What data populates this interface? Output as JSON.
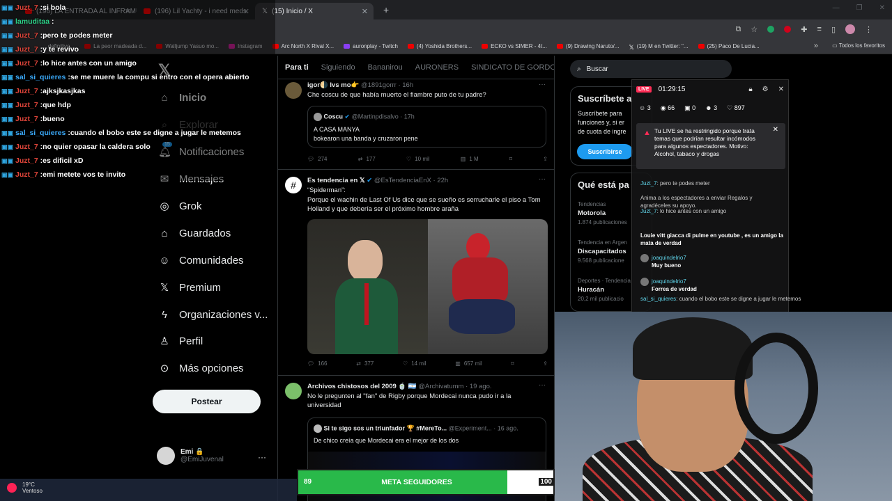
{
  "browser": {
    "tabs": [
      {
        "label": "(196) LA ENTRADA AL INFRAMU",
        "active": false
      },
      {
        "label": "(196) Lil Yachty - i need meds",
        "active": false
      },
      {
        "label": "(15) Inicio / X",
        "active": true
      }
    ],
    "new_tab": "+",
    "bookmarks": [
      {
        "label": "... definitivo..."
      },
      {
        "label": "La peor madeada d..."
      },
      {
        "label": "Walljump Yasuo mo..."
      },
      {
        "label": "Instagram"
      },
      {
        "label": "Arc North X Rival X..."
      },
      {
        "label": "auronplay - Twitch"
      },
      {
        "label": "(4) Yoshida Brothers..."
      },
      {
        "label": "ECKO vs SIMER - 4t..."
      },
      {
        "label": "(9) Drawing Naruto/..."
      },
      {
        "label": "(19) M en Twitter: \"..."
      },
      {
        "label": "(25) Paco De Lucia..."
      }
    ],
    "bookmarks_more": "»",
    "all_bookmarks": "Todos los favoritos"
  },
  "chat": [
    {
      "user": "Juzt_7",
      "msg": "si bola",
      "color": "red"
    },
    {
      "user": "lamuditaa",
      "msg": "",
      "color": "green"
    },
    {
      "user": "Juzt_7",
      "msg": "pero te podes meter",
      "color": "red"
    },
    {
      "user": "Juzt_7",
      "msg": "y te revivo",
      "color": "red"
    },
    {
      "user": "Juzt_7",
      "msg": "lo hice antes con un amigo",
      "color": "red"
    },
    {
      "user": "sal_si_quieres",
      "msg": "se me muere la compu si entro con el opera abierto",
      "color": "blue"
    },
    {
      "user": "Juzt_7",
      "msg": "ajksjkasjkas",
      "color": "red"
    },
    {
      "user": "Juzt_7",
      "msg": "que hdp",
      "color": "red"
    },
    {
      "user": "Juzt_7",
      "msg": "bueno",
      "color": "red"
    },
    {
      "user": "sal_si_quieres",
      "msg": "cuando el bobo este se digne a jugar le metemos",
      "color": "blue"
    },
    {
      "user": "Juzt_7",
      "msg": "no quier opasar la caldera solo",
      "color": "red"
    },
    {
      "user": "Juzt_7",
      "msg": "es dificil xD",
      "color": "red"
    },
    {
      "user": "Juzt_7",
      "msg": "emi metete vos te invito",
      "color": "red"
    }
  ],
  "sidebar": {
    "items": [
      {
        "label": "Inicio",
        "icon": "home-icon"
      },
      {
        "label": "Explorar",
        "icon": "search-icon"
      },
      {
        "label": "Notificaciones",
        "icon": "bell-icon",
        "badge": "15"
      },
      {
        "label": "Mensajes",
        "icon": "mail-icon"
      },
      {
        "label": "Grok",
        "icon": "grok-icon"
      },
      {
        "label": "Guardados",
        "icon": "bookmark-icon"
      },
      {
        "label": "Comunidades",
        "icon": "people-icon"
      },
      {
        "label": "Premium",
        "icon": "x-icon"
      },
      {
        "label": "Organizaciones v...",
        "icon": "bolt-icon"
      },
      {
        "label": "Perfil",
        "icon": "person-icon"
      },
      {
        "label": "Más opciones",
        "icon": "more-circle-icon"
      }
    ],
    "post_button": "Postear",
    "account": {
      "name": "Emi 🔒",
      "handle": "@EmiJuvenal"
    }
  },
  "feed": {
    "tabs": [
      "Para ti",
      "Siguiendo",
      "Bananirou",
      "AURONERS",
      "SINDICATO DE GORDOS V"
    ],
    "tweets": [
      {
        "name": "igor🌗 lvs mo👉",
        "handle": "@1891gorrr · 16h",
        "text": "Che coscu de que había muerto el fiambre puto de tu padre?",
        "quote": {
          "name": "Coscu",
          "handle": "@Martinpdisalvo · 17h",
          "text1": "A CASA MANYA",
          "text2": "bokearon una banda y cruzaron pene"
        },
        "actions": [
          "274",
          "177",
          "10 mil",
          "1 M"
        ]
      },
      {
        "name": "Es tendencia en 𝕏",
        "handle": "@EsTendenciaEnX · 22h",
        "text1": "“Spiderman”:",
        "text2": "Porque el wachin de Last Of Us dice que se sueño es serrucharle el piso a Tom Holland y que debería ser el próximo hombre araña",
        "actions": [
          "166",
          "377",
          "14 mil",
          "657 mil"
        ]
      },
      {
        "name": "Archivos chistosos del 2009 🍵 🇦🇷",
        "handle": "@Archivatumm · 19 ago.",
        "text": "No le pregunten al \"fan\" de Rigby porque Mordecai nunca pudo ir a la universidad",
        "quote": {
          "name": "Si te sigo sos un triunfador 🏆 #MereTo...",
          "handle": "@Experiment... · 16 ago.",
          "text1": "De chico creía que Mordecai era el mejor de los dos"
        }
      }
    ]
  },
  "right": {
    "search_placeholder": "Buscar",
    "subscribe": {
      "title": "Suscríbete a",
      "line1": "Suscríbete para",
      "line2": "funciones y, si er",
      "line3": "de cuota de ingre",
      "button": "Suscribirse"
    },
    "trends": {
      "title": "Qué está pa",
      "items": [
        {
          "cat": "Tendencias",
          "name": "Motorola",
          "count": "1.874 publicaciones"
        },
        {
          "cat": "Tendencia en Argen",
          "name": "Discapacitados",
          "count": "9.568 publicacione"
        },
        {
          "cat": "Deportes · Tendencia",
          "name": "Huracán",
          "count": "20,2 mil publicacio"
        }
      ]
    }
  },
  "live": {
    "badge": "LIVE",
    "time": "01:29:15",
    "stats": [
      "3",
      "66",
      "0",
      "3",
      "897"
    ],
    "warning": "Tu LIVE se ha restringido porque trata temas que podrían resultar incómodos para algunos espectadores. Motivo: Alcohol, tabaco y drogas",
    "comments": [
      {
        "user": "Juzt_7",
        "msg": ": pero te podes meter"
      },
      {
        "user": "",
        "msg": "Anima a los espectadores a enviar Regalos y agradéceles su apoyo."
      },
      {
        "user": "Juzt_7",
        "msg": ": lo hice antes con un amigo"
      },
      {
        "user": "",
        "msg": "Louie vitt giacca di pulme en youtube , es un amigo la mata de verdad"
      },
      {
        "user": "joaquindelrio7",
        "msg": "Muy bueno"
      },
      {
        "user": "joaquindelrio7",
        "msg": "Forrea de verdad"
      },
      {
        "user": "sal_si_quieres",
        "msg": ": cuando el bobo este se digne a jugar le metemos"
      }
    ]
  },
  "goal": {
    "current": "89",
    "label": "META SEGUIDORES",
    "target": "100",
    "progress": 0.89
  },
  "taskbar": {
    "temp": "19°C",
    "condition": "Ventoso"
  }
}
